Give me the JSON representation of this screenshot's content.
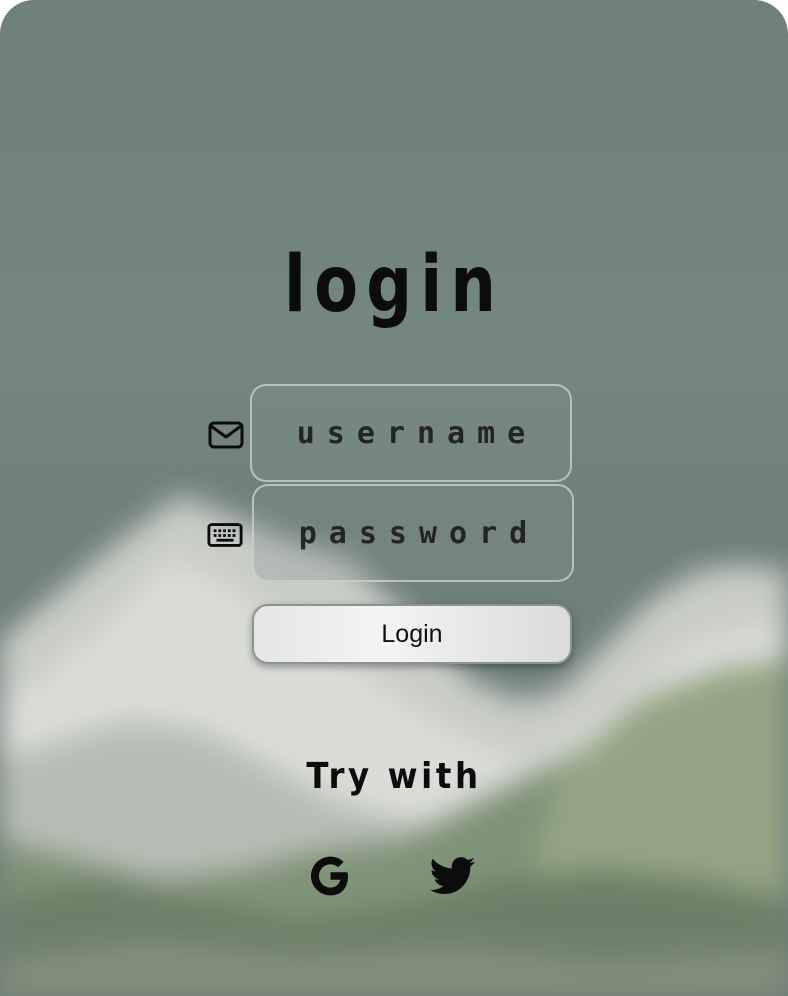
{
  "form": {
    "title": "login",
    "username": {
      "icon": "envelope-icon",
      "placeholder": "username",
      "value": ""
    },
    "password": {
      "icon": "keyboard-icon",
      "placeholder": "password",
      "value": ""
    },
    "submit_label": "Login"
  },
  "social": {
    "heading": "Try with",
    "providers": [
      {
        "name": "Google",
        "icon": "google-icon"
      },
      {
        "name": "Twitter",
        "icon": "twitter-icon"
      }
    ]
  },
  "colors": {
    "background": "#72847e",
    "text": "#0c0c0c",
    "field_border": "#cdd4d0",
    "button_fill": "#ececec"
  }
}
